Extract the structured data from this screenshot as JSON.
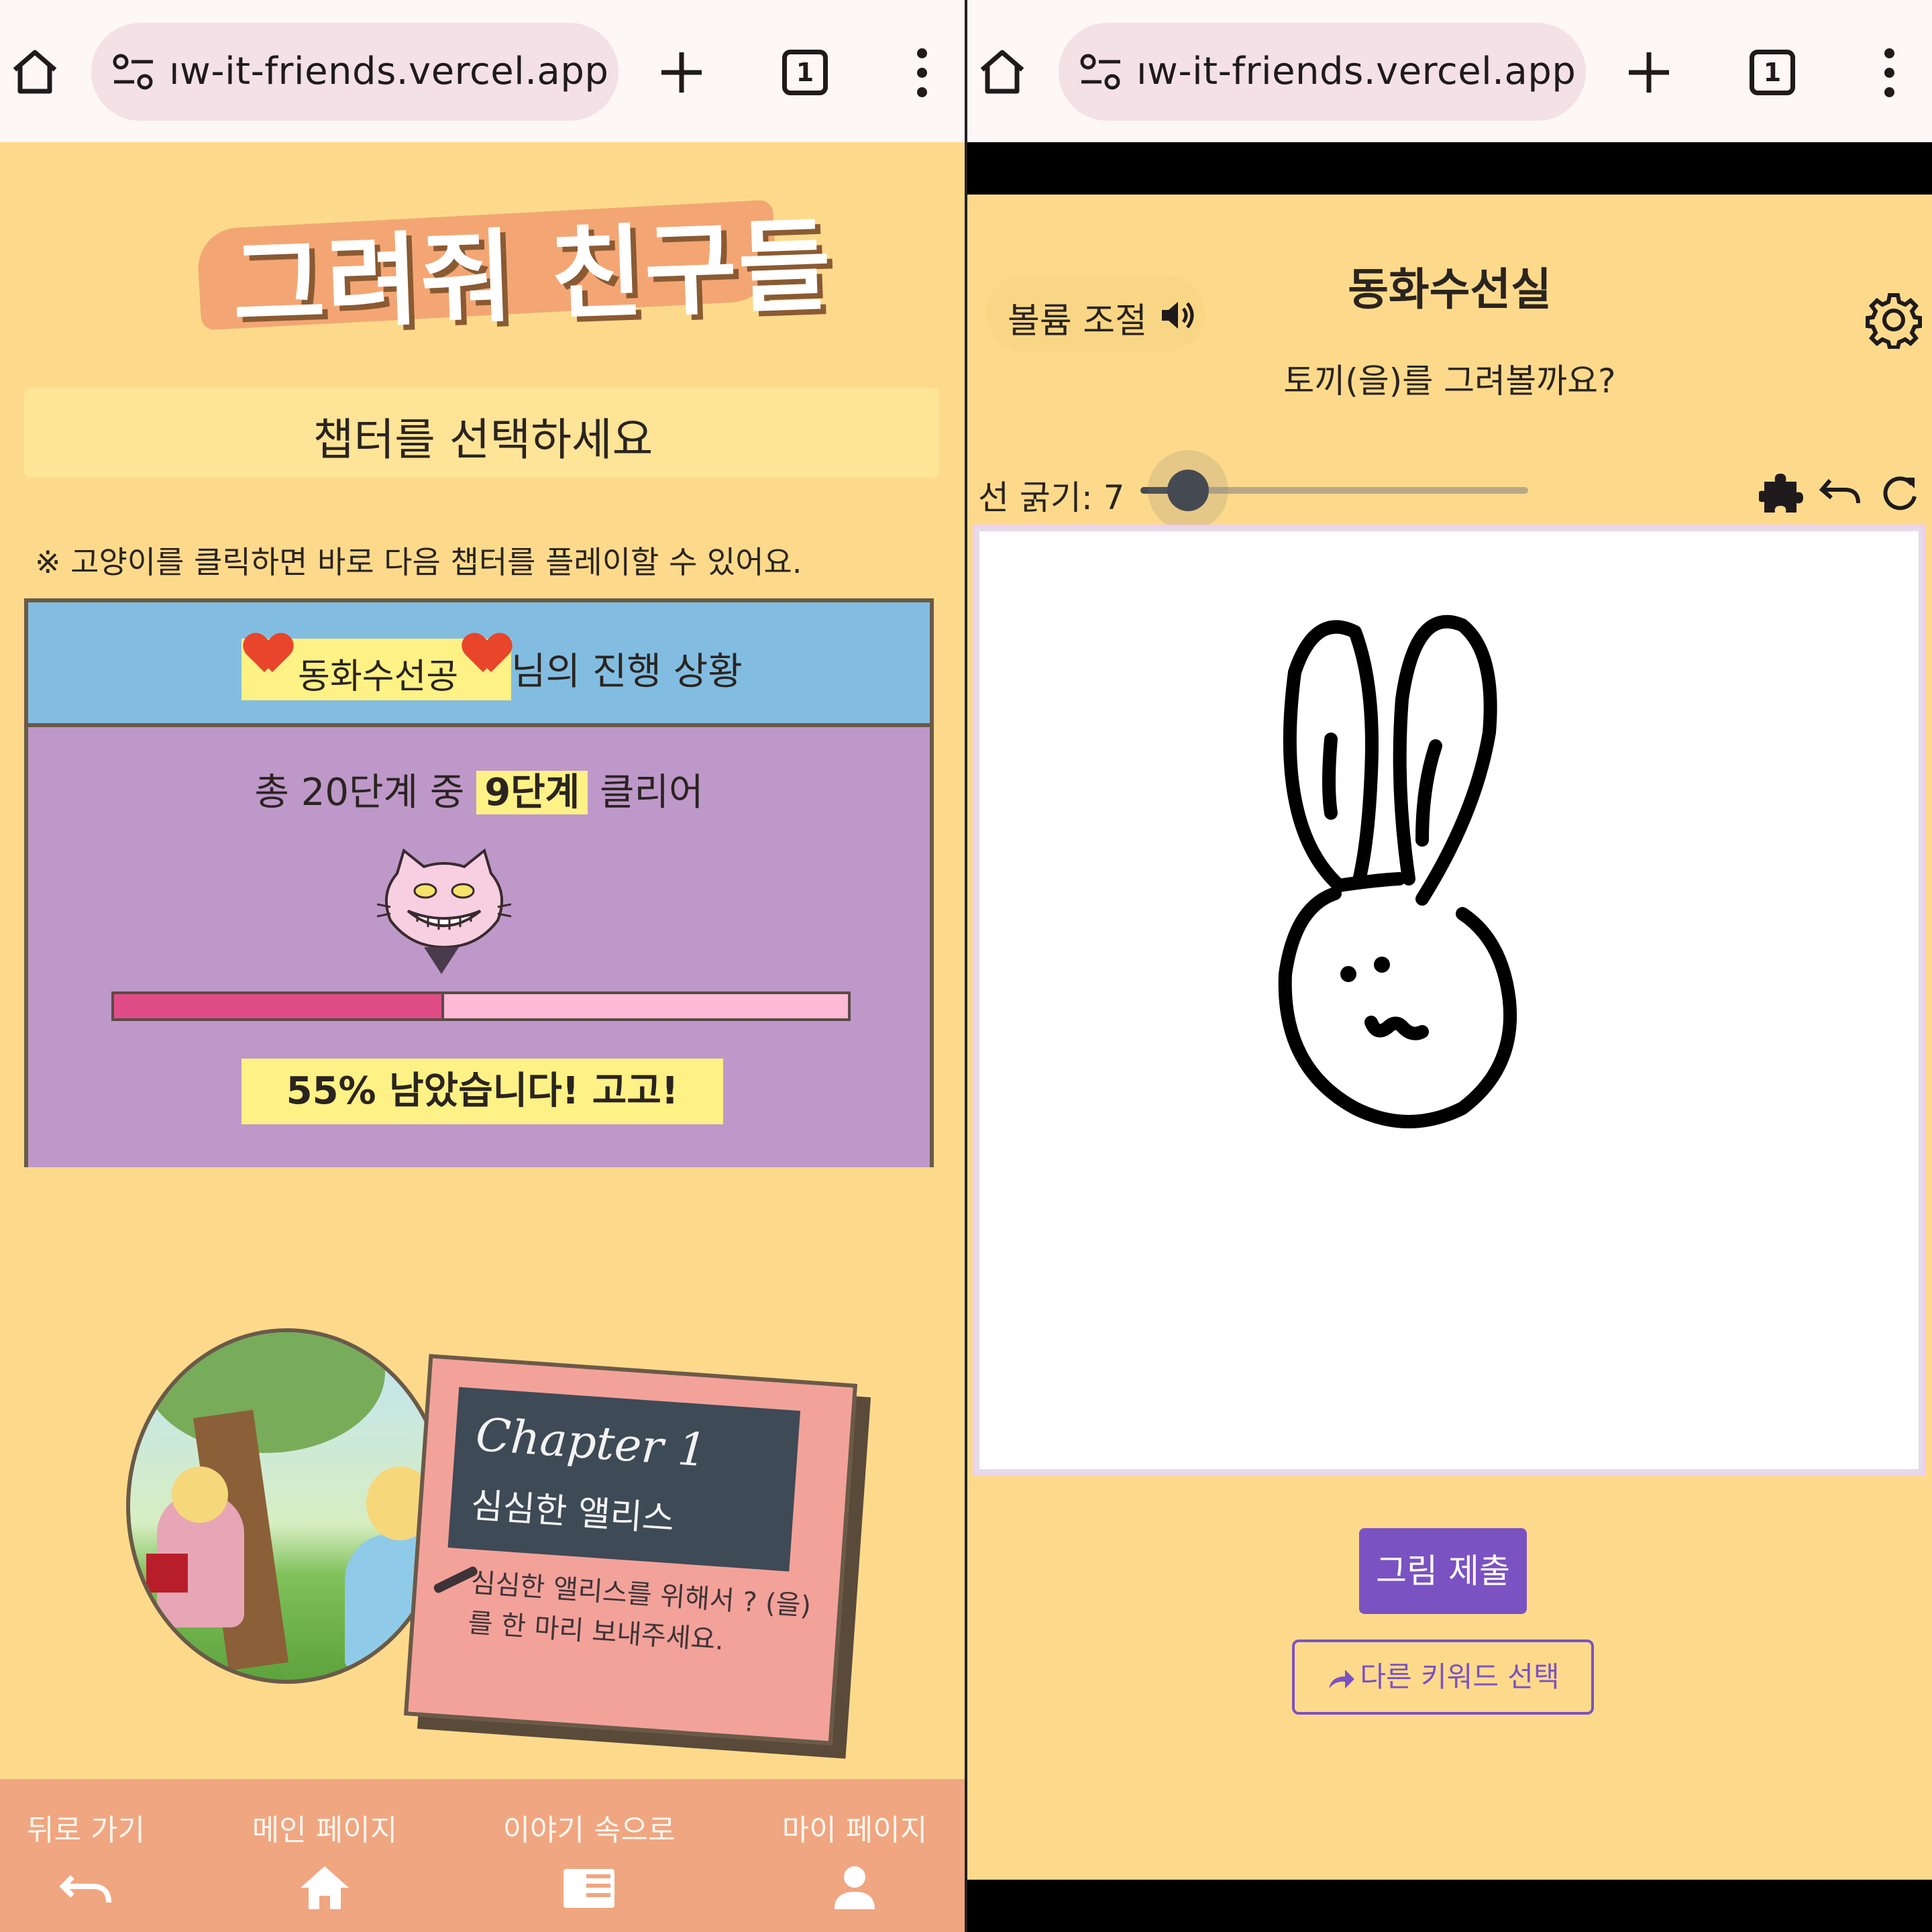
{
  "browser": {
    "url": "ıw-it-friends.vercel.app",
    "tab_count": "1"
  },
  "left": {
    "logo_text": "그려줘 친구들",
    "chapter_prompt": "챕터를 선택하세요",
    "hint": "※ 고양이를 클릭하면 바로 다음 챕터를 플레이할 수 있어요.",
    "progress": {
      "username": "동화수선공",
      "suffix": "님의 진행 상황",
      "total_prefix": "총 20단계 중",
      "cleared": "9단계",
      "total_suffix": "클리어",
      "completed_fraction": 0.45,
      "remaining_text": "55% 남았습니다! 고고!"
    },
    "chapter_card": {
      "chapter": "Chapter 1",
      "subtitle": "심심한 앨리스",
      "description": "심심한 앨리스를 위해서 ? (을)를 한 마리 보내주세요."
    },
    "bottom_nav": [
      {
        "label": "뒤로 가기",
        "icon": "undo-icon"
      },
      {
        "label": "메인 페이지",
        "icon": "home-icon"
      },
      {
        "label": "이야기 속으로",
        "icon": "book-icon"
      },
      {
        "label": "마이 페이지",
        "icon": "person-icon"
      }
    ]
  },
  "right": {
    "volume_label": "볼륨 조절",
    "title": "동화수선실",
    "prompt": "토끼(을)를 그려볼까요?",
    "stroke_label": "선 굵기: 7",
    "stroke_value": 7,
    "submit_label": "그림 제출",
    "other_keyword_label": "다른 키워드 선택"
  },
  "colors": {
    "page_bg": "#fdda8b",
    "progress_head": "#82bde1",
    "progress_body": "#be98c9",
    "bar_fill": "#e04d86",
    "bar_track": "#fdbad5",
    "highlight": "#fef185",
    "nav_bg": "#f0a680",
    "accent_purple": "#7b52c2"
  }
}
